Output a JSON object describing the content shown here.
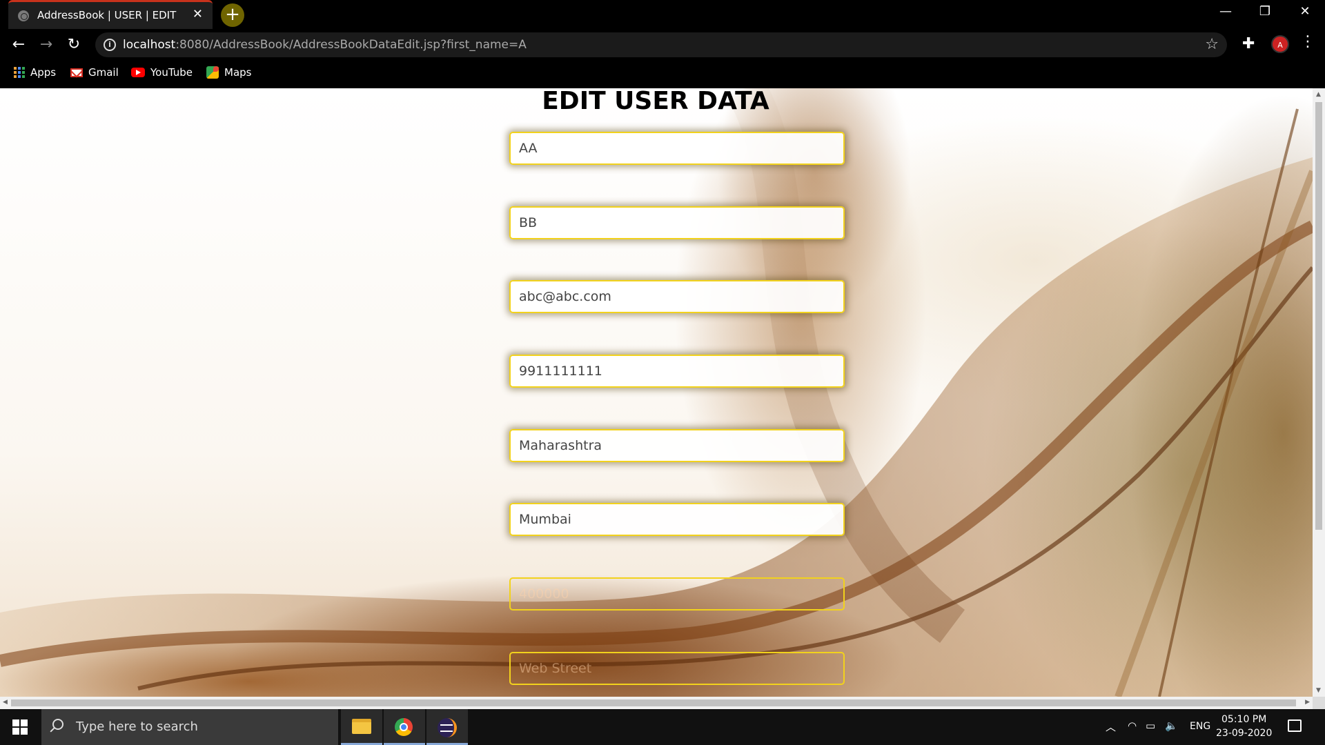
{
  "browser": {
    "tab_title": "AddressBook | USER | EDIT",
    "tab_close": "✕",
    "new_tab": "+",
    "url_host": "localhost",
    "url_rest": ":8080/AddressBook/AddressBookDataEdit.jsp?first_name=A",
    "bookmarks": [
      {
        "label": "Apps",
        "icon": "apps-grid-icon"
      },
      {
        "label": "Gmail",
        "icon": "gmail-icon"
      },
      {
        "label": "YouTube",
        "icon": "youtube-icon"
      },
      {
        "label": "Maps",
        "icon": "maps-icon"
      }
    ],
    "profile_initial": "A"
  },
  "page": {
    "title": "EDIT USER DATA",
    "fields": [
      {
        "name": "first-name",
        "value": "AA",
        "placeholder": ""
      },
      {
        "name": "last-name",
        "value": "BB",
        "placeholder": ""
      },
      {
        "name": "email",
        "value": "abc@abc.com",
        "placeholder": ""
      },
      {
        "name": "phone",
        "value": "9911111111",
        "placeholder": ""
      },
      {
        "name": "state",
        "value": "Maharashtra",
        "placeholder": ""
      },
      {
        "name": "city",
        "value": "Mumbai",
        "placeholder": ""
      },
      {
        "name": "zip",
        "value": "",
        "placeholder": "400000"
      },
      {
        "name": "street",
        "value": "",
        "placeholder": "Web Street"
      }
    ],
    "accent_color": "#f2d21c"
  },
  "taskbar": {
    "search_placeholder": "Type here to search",
    "language": "ENG",
    "time": "05:10 PM",
    "date": "23-09-2020"
  }
}
